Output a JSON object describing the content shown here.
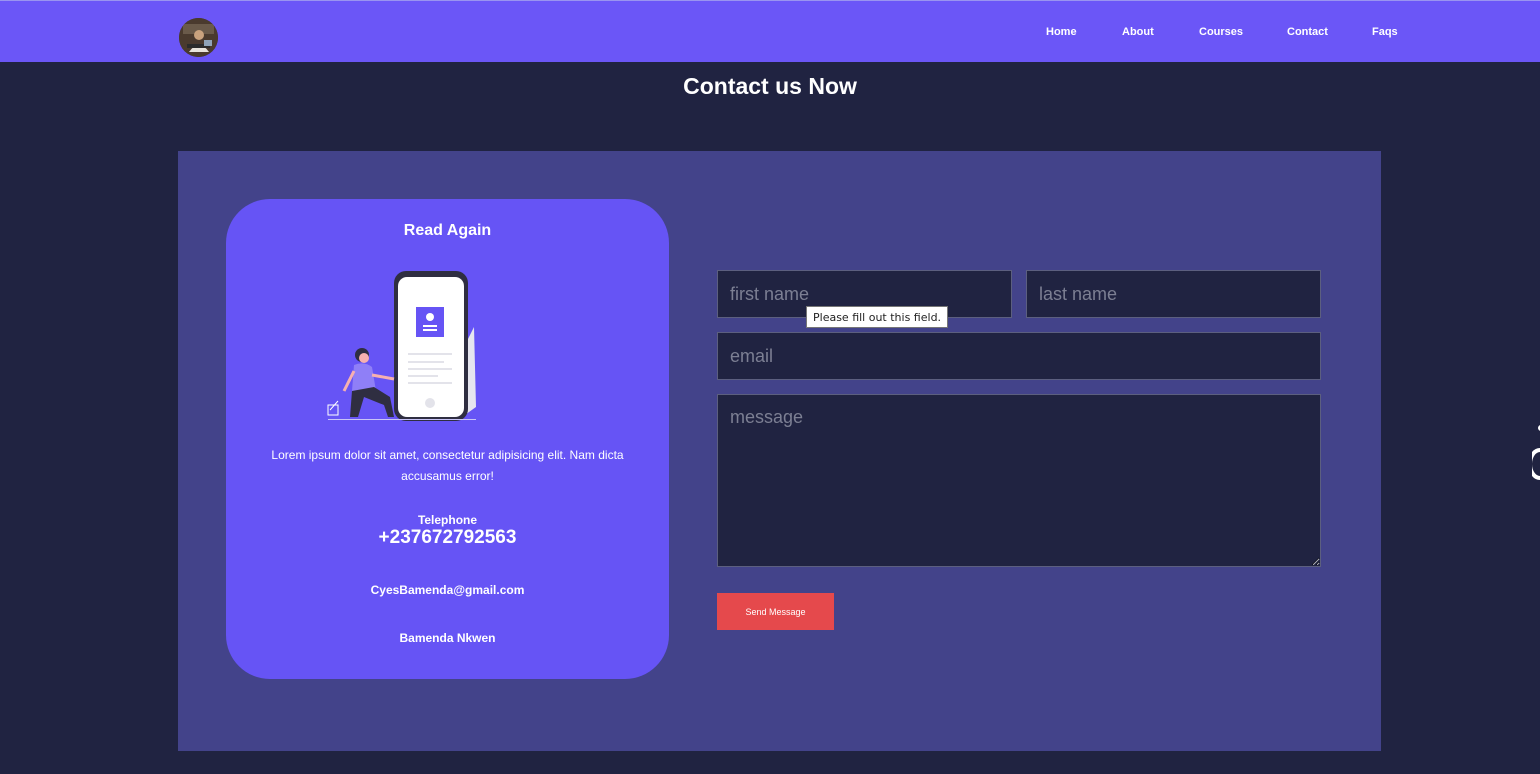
{
  "nav": {
    "items": [
      {
        "label": "Home"
      },
      {
        "label": "About"
      },
      {
        "label": "Courses"
      },
      {
        "label": "Contact"
      },
      {
        "label": "Faqs"
      }
    ]
  },
  "page": {
    "title": "Contact us Now"
  },
  "card": {
    "title": "Read Again",
    "description": "Lorem ipsum dolor sit amet, consectetur adipisicing elit. Nam dicta accusamus error!",
    "telephone_label": "Telephone",
    "telephone": "+237672792563",
    "email": "CyesBamenda@gmail.com",
    "address": "Bamenda Nkwen"
  },
  "form": {
    "first_name_placeholder": "first name",
    "last_name_placeholder": "last name",
    "email_placeholder": "email",
    "message_placeholder": "message",
    "send_label": "Send Message",
    "validation_tooltip": "Please fill out this field."
  },
  "colors": {
    "navbar": "#6b56f7",
    "background": "#202341",
    "panel": "#43438a",
    "card": "#6654f5",
    "button": "#e5494c"
  }
}
